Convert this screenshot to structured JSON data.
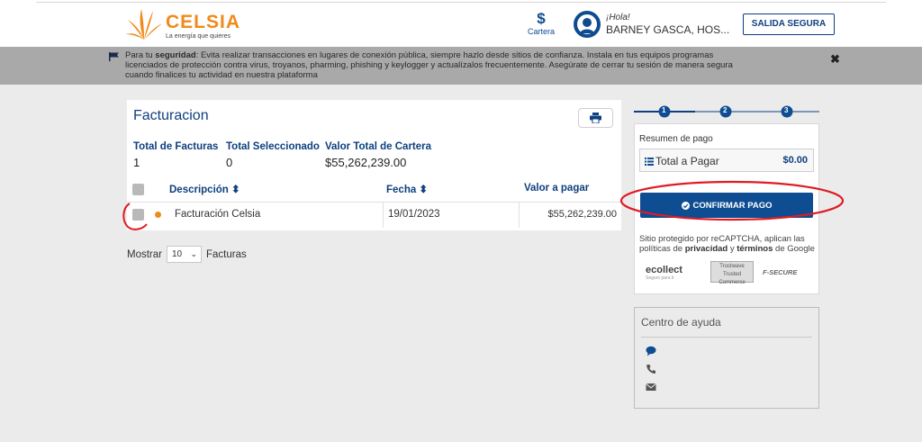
{
  "header": {
    "logo_name": "CELSIA",
    "logo_tagline": "La energía que quieres",
    "cartera_symbol": "$",
    "cartera_label": "Cartera",
    "greeting": "¡Hola!",
    "user_name": "BARNEY GASCA, HOS...",
    "logout_label": "SALIDA SEGURA"
  },
  "banner": {
    "prefix": "Para tu ",
    "keyword": "seguridad",
    "message": ": Evita realizar transacciones en lugares de conexión pública, siempre hazlo desde sitios de confianza. Instala en tus equipos programas licenciados de protección contra virus, troyanos, pharming, phishing y keylogger y actualízalos frecuentemente. Asegúrate de cerrar tu sesión de manera segura cuando finalices tu actividad en nuestra plataforma",
    "close_symbol": "✖"
  },
  "facturacion": {
    "title": "Facturacion",
    "stats": [
      {
        "label": "Total de Facturas",
        "value": "1"
      },
      {
        "label": "Total Seleccionado",
        "value": "0"
      },
      {
        "label": "Valor Total de Cartera",
        "value": "$55,262,239.00"
      }
    ],
    "columns": {
      "descripcion": "Descripción ⬍",
      "fecha": "Fecha ⬍",
      "valor": "Valor a pagar"
    },
    "rows": [
      {
        "descripcion": "Facturación Celsia",
        "fecha": "19/01/2023",
        "valor": "$55,262,239.00"
      }
    ],
    "show_label": "Mostrar",
    "page_size": "10",
    "show_suffix": "Facturas"
  },
  "stepper": {
    "steps": [
      "1",
      "2",
      "3"
    ],
    "active_step": 1
  },
  "resumen": {
    "title": "Resumen de pago",
    "total_label": "Total a Pagar",
    "total_value": "$0.00",
    "confirm_label": "CONFIRMAR PAGO",
    "recaptcha_pre": "Sitio protegido por reCAPTCHA, aplican las políticas de ",
    "privacidad": "privacidad",
    "recaptcha_mid": " y ",
    "terminos": "términos",
    "recaptcha_post": " de Google",
    "badge_ecollect": "ecollect",
    "badge_ecollect_sub": "Seguro para ti",
    "badge_trustwave": "Trustwave",
    "badge_trustwave_sub": "Trusted Commerce",
    "badge_fsecure": "F-SECURE"
  },
  "ayuda": {
    "title": "Centro de ayuda"
  },
  "colors": {
    "brand_orange": "#f08a1c",
    "brand_blue": "#0e3f7f",
    "annotation_red": "#e01b24"
  }
}
